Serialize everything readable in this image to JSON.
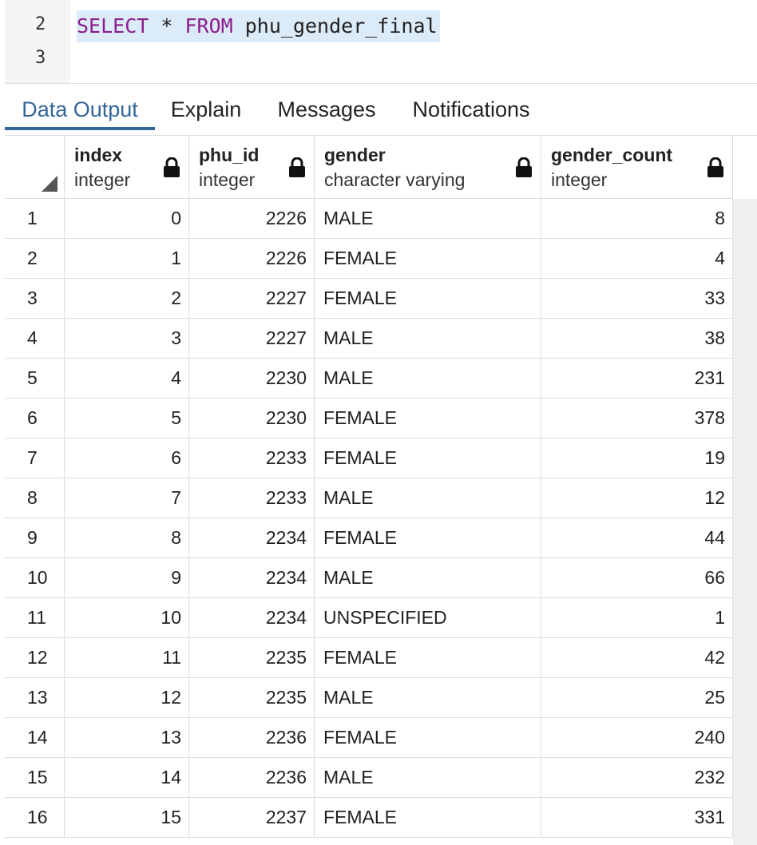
{
  "editor": {
    "line_numbers": [
      "2",
      "3"
    ],
    "query_keyword_select": "SELECT",
    "query_star": " * ",
    "query_keyword_from": "FROM",
    "query_table": " phu_gender_final"
  },
  "tabs": [
    {
      "label": "Data Output",
      "active": true
    },
    {
      "label": "Explain",
      "active": false
    },
    {
      "label": "Messages",
      "active": false
    },
    {
      "label": "Notifications",
      "active": false
    }
  ],
  "grid": {
    "columns": [
      {
        "name": "index",
        "type": "integer"
      },
      {
        "name": "phu_id",
        "type": "integer"
      },
      {
        "name": "gender",
        "type": "character varying"
      },
      {
        "name": "gender_count",
        "type": "integer"
      }
    ],
    "rows": [
      [
        "1",
        "0",
        "2226",
        "MALE",
        "8"
      ],
      [
        "2",
        "1",
        "2226",
        "FEMALE",
        "4"
      ],
      [
        "3",
        "2",
        "2227",
        "FEMALE",
        "33"
      ],
      [
        "4",
        "3",
        "2227",
        "MALE",
        "38"
      ],
      [
        "5",
        "4",
        "2230",
        "MALE",
        "231"
      ],
      [
        "6",
        "5",
        "2230",
        "FEMALE",
        "378"
      ],
      [
        "7",
        "6",
        "2233",
        "FEMALE",
        "19"
      ],
      [
        "8",
        "7",
        "2233",
        "MALE",
        "12"
      ],
      [
        "9",
        "8",
        "2234",
        "FEMALE",
        "44"
      ],
      [
        "10",
        "9",
        "2234",
        "MALE",
        "66"
      ],
      [
        "11",
        "10",
        "2234",
        "UNSPECIFIED",
        "1"
      ],
      [
        "12",
        "11",
        "2235",
        "FEMALE",
        "42"
      ],
      [
        "13",
        "12",
        "2235",
        "MALE",
        "25"
      ],
      [
        "14",
        "13",
        "2236",
        "FEMALE",
        "240"
      ],
      [
        "15",
        "14",
        "2236",
        "MALE",
        "232"
      ],
      [
        "16",
        "15",
        "2237",
        "FEMALE",
        "331"
      ]
    ]
  },
  "colors": {
    "accent": "#336699",
    "keyword": "#8b1c8d",
    "selection": "#dcebf8"
  }
}
